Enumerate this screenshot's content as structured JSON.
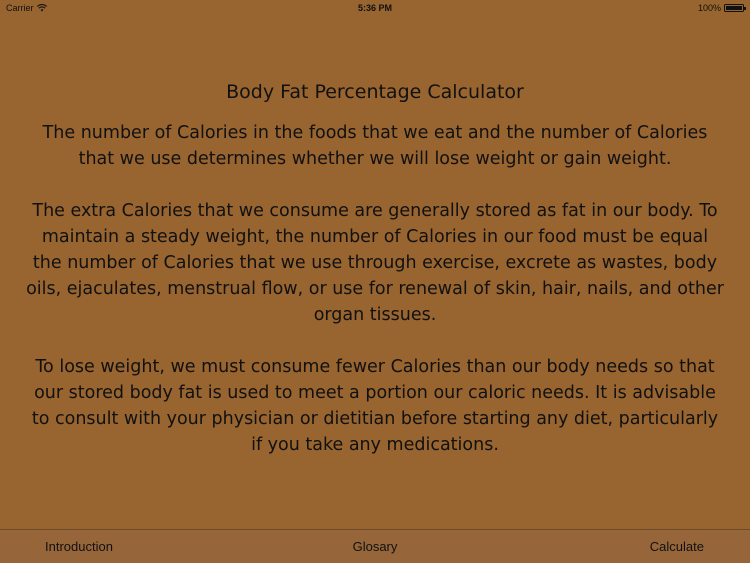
{
  "status_bar": {
    "carrier": "Carrier",
    "time": "5:36 PM",
    "battery": "100%",
    "battery_level": 1.0
  },
  "main": {
    "title": "Body Fat Percentage Calculator",
    "paragraphs": [
      "The number of Calories in the foods that we eat and the number of Calories that we use determines whether we will lose weight or gain weight.",
      "The extra Calories that we consume are generally stored as fat in our body. To maintain a steady weight, the number of Calories in our food must be equal the number of Calories that we use through exercise, excrete as wastes, body oils, ejaculates, menstrual flow, or use for renewal of skin, hair, nails, and other organ tissues.",
      "To lose weight, we must consume fewer Calories than our body needs so that our stored body fat is used to meet a portion our caloric needs. It is advisable to consult with your physician or dietitian before starting any diet, particularly if you take any medications."
    ]
  },
  "tab_bar": {
    "introduction": "Introduction",
    "glossary": "Glosary",
    "calculate": "Calculate"
  },
  "colors": {
    "background": "#98642f",
    "tab_bar": "#96663a",
    "text": "#111111"
  }
}
